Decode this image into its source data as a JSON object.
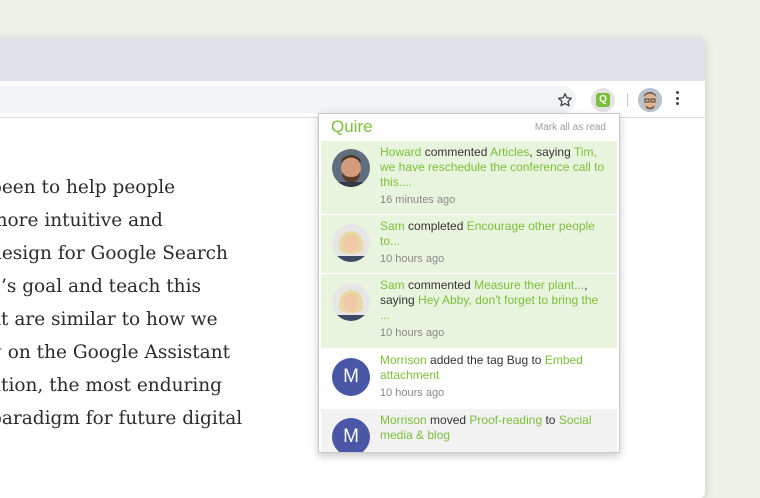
{
  "article": {
    "lines": [
      "been to help people",
      "more intuitive and",
      "design for Google Search",
      "e’s goal and teach this",
      "at are similar to how we",
      "g on the Google Assistant",
      "ation, the most enduring",
      "paradigm for future digital"
    ]
  },
  "toolbar": {
    "extension_letter": "Q"
  },
  "popup": {
    "brand": "Quire",
    "mark_all_read": "Mark all as read",
    "notifications": [
      {
        "actor": "Howard",
        "action": "commented",
        "target": "Articles",
        "rest": ", saying",
        "quote": "Tim, we have reschedule the conference call to this....",
        "time": "16 minutes ago"
      },
      {
        "actor": "Sam",
        "action": "completed",
        "target": "Encourage other people to...",
        "time": "10 hours ago"
      },
      {
        "actor": "Sam",
        "action": "commented",
        "target": "Measure ther plant...",
        "rest": ",",
        "rest2": "saying",
        "quote": "Hey Abby, don't forget to bring the ...",
        "time": "10 hours ago"
      },
      {
        "actor": "Morrison",
        "action": "added the tag Bug to",
        "target": "Embed attachment",
        "time": "10 hours ago",
        "avatar_letter": "M"
      },
      {
        "actor": "Morrison",
        "action": "moved",
        "target": "Proof-reading",
        "rest": "to",
        "target2": "Social media & blog",
        "avatar_letter": "M"
      }
    ]
  },
  "colors": {
    "accent": "#7bbf3a",
    "unread_bg": "#e9f4de",
    "letter_avatar": "#4a57a6"
  }
}
